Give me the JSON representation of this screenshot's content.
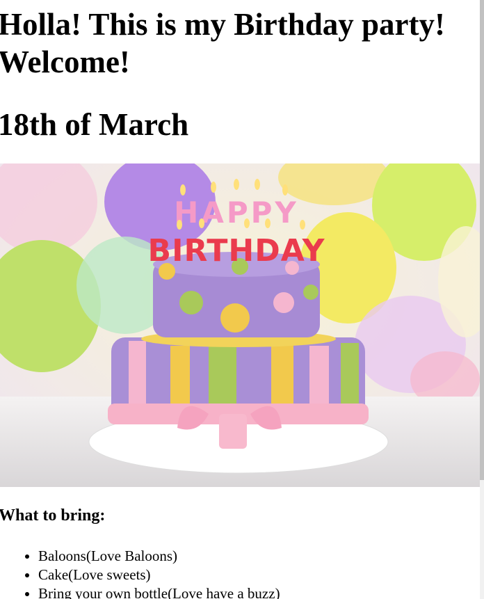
{
  "header": {
    "title": "Holla! This is my Birthday party! Welcome!",
    "date": "18th of March"
  },
  "hero": {
    "image_label": "HAPPY BIRTHDAY cake with candles and balloons",
    "cake_text_top": "HAPPY",
    "cake_text_bottom": "BIRTHDAY",
    "colors": {
      "cake_purple": "#a98fd6",
      "cake_green": "#a9c95a",
      "cake_yellow": "#f2c94c",
      "cake_pink": "#f5b6cf",
      "balloon_yellow": "#f3ea63",
      "balloon_purple": "#b48ae6",
      "balloon_green": "#bfe06a"
    }
  },
  "bring": {
    "title": "What to bring:",
    "items": [
      "Baloons(Love Baloons)",
      "Cake(Love sweets)",
      "Bring your own bottle(Love have a buzz)"
    ]
  }
}
